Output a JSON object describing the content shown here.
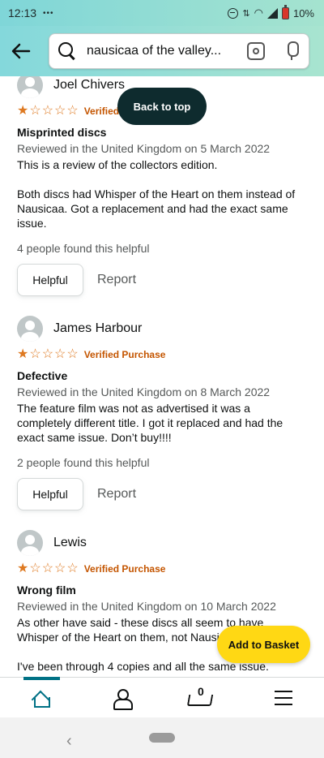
{
  "status": {
    "time": "12:13",
    "dots": "•••",
    "battery": "10%"
  },
  "search": {
    "query": "nausicaa of the valley..."
  },
  "floating": {
    "back_to_top": "Back to top",
    "add_to_basket": "Add to Basket"
  },
  "colors": {
    "accent": "#007185",
    "star": "#de7921",
    "verified": "#c45500",
    "add_button": "#ffd814"
  },
  "reviews": [
    {
      "name": "Joel Chivers",
      "rating": 1,
      "verified": "Verified Purchase",
      "title": "Misprinted discs",
      "date": "Reviewed in the United Kingdom on 5 March 2022",
      "body": "This is a review of the collectors edition.\n\nBoth discs had Whisper of the Heart on them instead of Nausicaa. Got a replacement and had the exact same issue.",
      "helpful_count": "4 people found this helpful",
      "helpful_label": "Helpful",
      "report_label": "Report"
    },
    {
      "name": "James Harbour",
      "rating": 1,
      "verified": "Verified Purchase",
      "title": "Defective",
      "date": "Reviewed in the United Kingdom on 8 March 2022",
      "body": "The feature film was not as advertised it was a completely different title. I got it replaced and had the exact same issue. Don’t buy!!!!",
      "helpful_count": "2 people found this helpful",
      "helpful_label": "Helpful",
      "report_label": "Report"
    },
    {
      "name": "Lewis",
      "rating": 1,
      "verified": "Verified Purchase",
      "title": "Wrong film",
      "date": "Reviewed in the United Kingdom on 10 March 2022",
      "body": "As other have said - these discs all seem to have Whisper of the Heart on them, not Nausicaa.\n\nI've been through 4 copies and all the same issue."
    }
  ],
  "bottom_nav": {
    "cart_count": "0"
  }
}
